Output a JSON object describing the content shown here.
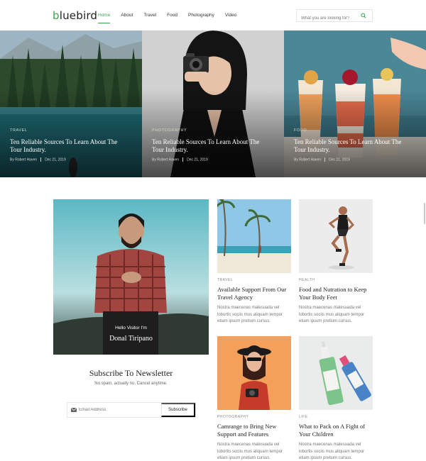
{
  "brand": {
    "logo_b": "b",
    "logo_rest": "luebird"
  },
  "nav": [
    {
      "label": "Home",
      "active": true
    },
    {
      "label": "About"
    },
    {
      "label": "Travel"
    },
    {
      "label": "Food"
    },
    {
      "label": "Photography"
    },
    {
      "label": "Video"
    }
  ],
  "search": {
    "placeholder": "What you are looking for?",
    "icon": "search-icon"
  },
  "hero": [
    {
      "category": "Travel",
      "title": "Ten Reliable Sources To Learn About The Tour Industry.",
      "author": "By Robert Haven",
      "date": "Dec 21, 2019"
    },
    {
      "category": "Photography",
      "title": "Ten Reliable Sources To Learn About The Tour Industry.",
      "author": "By Robert Haven",
      "date": "Dec 21, 2019"
    },
    {
      "category": "Food",
      "title": "Ten Reliable Sources To Learn About The Tour Industry.",
      "author": "By Robert Haven",
      "date": "Dec 21, 2019"
    }
  ],
  "profile": {
    "greeting": "Hello Visitor I'm",
    "name": "Donal Tiripano"
  },
  "newsletter": {
    "title": "Subscribe To Newsletter",
    "subtitle": "No spam, actually no, Cancel anytime.",
    "email_placeholder": "Email Address",
    "button": "Subscribe"
  },
  "articles": [
    {
      "category": "Travel",
      "title": "Available Support From Our Travel Agency",
      "excerpt": "Nostra maecenas malesuada vel lobortis sociis mus aliquam tempor etiam ipsum pretium cursus."
    },
    {
      "category": "Health",
      "title": "Food and Nutration to Keep Your Body Feet",
      "excerpt": "Nostra maecenas malesuada vel lobortis sociis mus aliquam tempor etiam ipsum pretium cursus."
    },
    {
      "category": "Photography",
      "title": "Camrange to Bring New Support and Features",
      "excerpt": "Nostra maecenas malesuada vel lobortis sociis mus aliquam tempor etiam ipsum pretium cursus."
    },
    {
      "category": "Life",
      "title": "What to Pack on A Fight of Your Children",
      "excerpt": "Nostra maecenas malesuada vel lobortis sociis mus aliquam tempor etiam ipsum pretium cursus."
    }
  ],
  "colors": {
    "accent": "#3fa34d",
    "text": "#222222",
    "muted": "#777777"
  }
}
